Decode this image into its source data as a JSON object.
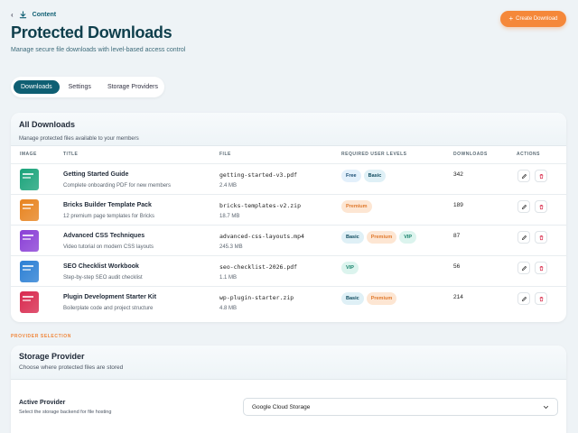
{
  "breadcrumb": {
    "label": "Content"
  },
  "page": {
    "title": "Protected Downloads",
    "subtitle": "Manage secure file downloads with level-based access control"
  },
  "header": {
    "create_label": "Create Download"
  },
  "tabs": [
    {
      "label": "Downloads",
      "active": true
    },
    {
      "label": "Settings",
      "active": false
    },
    {
      "label": "Storage Providers",
      "active": false
    }
  ],
  "downloads": {
    "title": "All Downloads",
    "description": "Manage protected files available to your members",
    "columns": {
      "image": "IMAGE",
      "title": "TITLE",
      "file": "FILE",
      "levels": "REQUIRED USER LEVELS",
      "downloads": "DOWNLOADS",
      "actions": "ACTIONS"
    },
    "rows": [
      {
        "title": "Getting Started Guide",
        "description": "Complete onboarding PDF for new members",
        "file": "getting-started-v3.pdf",
        "size": "2.4 MB",
        "levels": [
          "Free",
          "Basic"
        ],
        "downloads": "342",
        "thumb_color": "#1aa37a"
      },
      {
        "title": "Bricks Builder Template Pack",
        "description": "12 premium page templates for Bricks",
        "file": "bricks-templates-v2.zip",
        "size": "18.7 MB",
        "levels": [
          "Premium"
        ],
        "downloads": "189",
        "thumb_color": "#e7831f"
      },
      {
        "title": "Advanced CSS Techniques",
        "description": "Video tutorial on modern CSS layouts",
        "file": "advanced-css-layouts.mp4",
        "size": "245.3 MB",
        "levels": [
          "Basic",
          "Premium",
          "VIP"
        ],
        "downloads": "87",
        "thumb_color": "#8a3fd6"
      },
      {
        "title": "SEO Checklist Workbook",
        "description": "Step-by-step SEO audit checklist",
        "file": "seo-checklist-2026.pdf",
        "size": "1.1 MB",
        "levels": [
          "VIP"
        ],
        "downloads": "56",
        "thumb_color": "#2b7fd4"
      },
      {
        "title": "Plugin Development Starter Kit",
        "description": "Boilerplate code and project structure",
        "file": "wp-plugin-starter.zip",
        "size": "4.8 MB",
        "levels": [
          "Basic",
          "Premium"
        ],
        "downloads": "214",
        "thumb_color": "#d8294e"
      }
    ]
  },
  "provider_section_label": "PROVIDER SELECTION",
  "storage": {
    "title": "Storage Provider",
    "description": "Choose where protected files are stored",
    "active_label": "Active Provider",
    "active_desc": "Select the storage backend for file hosting",
    "selected": "Google Cloud Storage"
  },
  "colors": {
    "primary": "#0f5f73",
    "accent": "#f5883a",
    "delete": "#d9304f"
  },
  "icons": {
    "back": "chevron-left-icon",
    "breadcrumb": "download-icon",
    "create": "plus-icon",
    "edit": "pencil-icon",
    "delete": "trash-icon",
    "select": "chevron-down-icon"
  }
}
